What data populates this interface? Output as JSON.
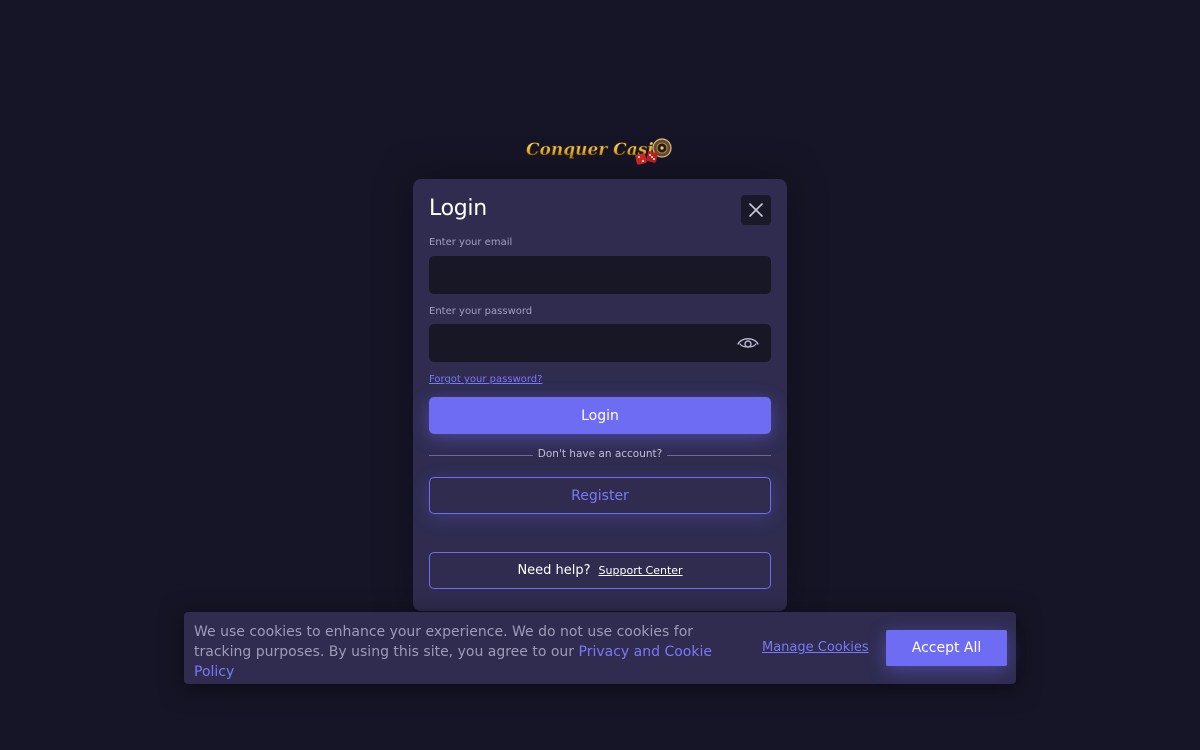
{
  "brand": {
    "logo_text": "Conquer Casino",
    "accent": "#6f6cf4",
    "background": "#161527",
    "panel": "#2f2c50"
  },
  "login_modal": {
    "title": "Login",
    "close_icon": "close-icon",
    "email_label": "Enter your email",
    "email_value": "",
    "password_label": "Enter your password",
    "password_value": "",
    "password_toggle_icon": "eye-icon",
    "forgot_link": "Forgot your password?",
    "login_button": "Login",
    "divider_text": "Don't have an account?",
    "register_button": "Register",
    "help_text": "Need help?",
    "support_link": "Support Center"
  },
  "cookie_banner": {
    "text": "We use cookies to enhance your experience. We do not use cookies for tracking purposes. By using this site, you agree to our",
    "policy_link": "Privacy and Cookie Policy",
    "manage_link": "Manage Cookies",
    "accept_button": "Accept All"
  }
}
